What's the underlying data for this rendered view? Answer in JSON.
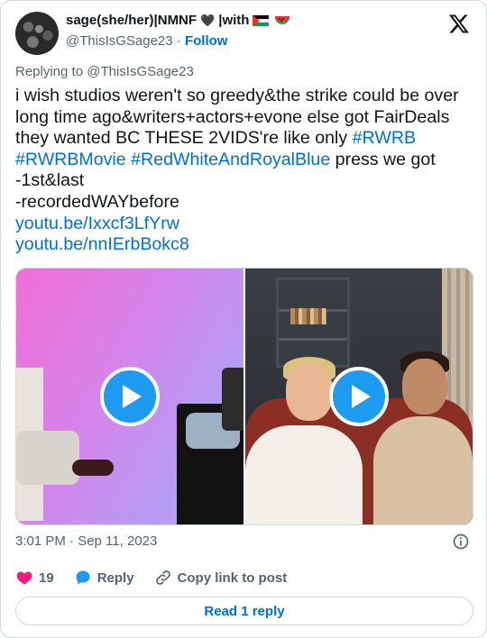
{
  "author": {
    "display_name": "sage(she/her)|NMNF",
    "heart_glyph": "🖤",
    "name_suffix": "|with",
    "handle": "@ThisIsGSage23",
    "separator": "·",
    "follow_label": "Follow"
  },
  "replying_to": "Replying to @ThisIsGSage23",
  "tweet": {
    "lines": [
      [
        {
          "text": "i wish studios weren't so greedy&the strike could be over",
          "link": false
        }
      ],
      [
        {
          "text": "long time ago&writers+actors+evone else got FairDeals",
          "link": false
        }
      ],
      [
        {
          "text": "they wanted BC THESE 2VIDS're like only ",
          "link": false
        },
        {
          "text": "#RWRB",
          "link": true
        }
      ],
      [
        {
          "text": "#RWRBMovie",
          "link": true
        },
        {
          "text": " ",
          "link": false
        },
        {
          "text": "#RedWhiteAndRoyalBlue",
          "link": true
        },
        {
          "text": " press we got",
          "link": false
        }
      ],
      [
        {
          "text": "-1st&last",
          "link": false
        }
      ],
      [
        {
          "text": "-recordedWAYbefore",
          "link": false
        }
      ],
      [
        {
          "text": "youtu.be/Ixxcf3LfYrw",
          "link": true
        }
      ],
      [
        {
          "text": "youtu.be/nnIErbBokc8",
          "link": true
        }
      ]
    ]
  },
  "media": [
    {
      "kind": "video",
      "scene": "pink-backdrop-interview"
    },
    {
      "kind": "video",
      "scene": "living-room-sofa"
    }
  ],
  "timestamp": "3:01 PM · Sep 11, 2023",
  "actions": {
    "like_count": "19",
    "reply_label": "Reply",
    "copy_link_label": "Copy link to post"
  },
  "read_reply_label": "Read 1 reply",
  "colors": {
    "link": "#006fd6",
    "play": "#1d9bf0",
    "like": "#f91880",
    "reply_icon": "#1d9bf0"
  }
}
